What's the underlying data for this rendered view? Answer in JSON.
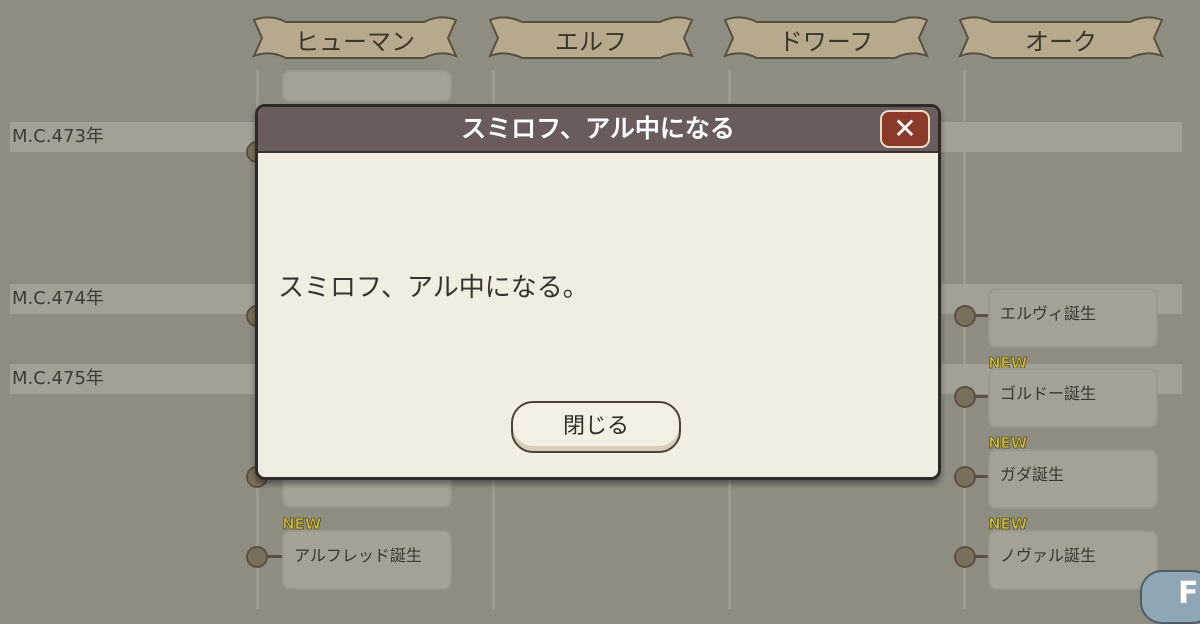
{
  "races": [
    "ヒューマン",
    "エルフ",
    "ドワーフ",
    "オーク"
  ],
  "years": [
    "M.C.473年",
    "M.C.474年",
    "M.C.475年"
  ],
  "events": {
    "elvi": "エルヴィ誕生",
    "goldo": "ゴルドー誕生",
    "gada": "ガダ誕生",
    "novar": "ノヴァル誕生",
    "alfred": "アルフレッド誕生"
  },
  "new_label": "NEW",
  "dialog": {
    "title": "スミロフ、アル中になる",
    "close_icon": "✕",
    "message": "スミロフ、アル中になる。",
    "close_button": "閉じる"
  },
  "corner": {
    "label": "Fi"
  }
}
